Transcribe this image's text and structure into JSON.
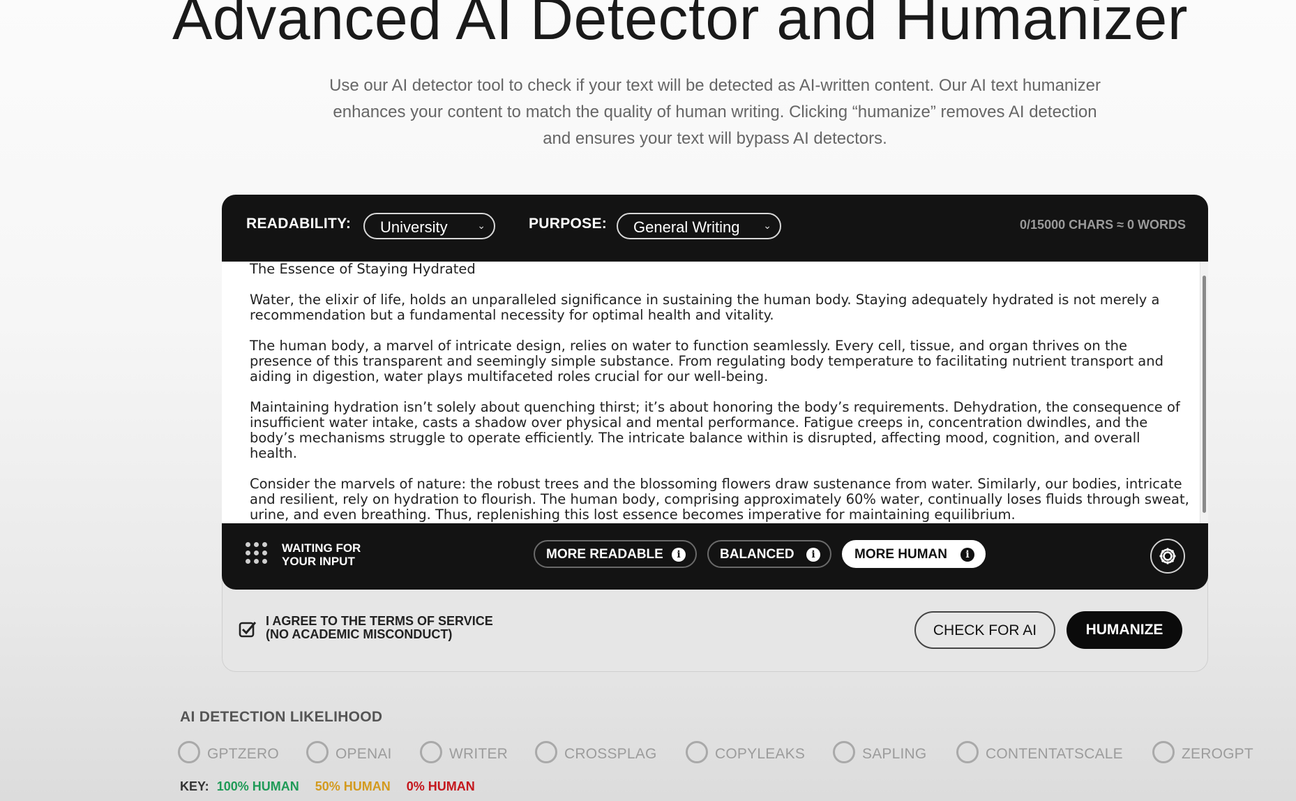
{
  "hero": {
    "title": "Advanced AI Detector and Humanizer",
    "subtitle": "Use our AI detector tool to check if your text will be detected as AI-written content. Our AI text humanizer enhances your content to match the quality of human writing. Clicking “humanize” removes AI detection and ensures your text will bypass AI detectors."
  },
  "toolbar": {
    "readability_label": "READABILITY:",
    "readability_value": "University",
    "purpose_label": "PURPOSE:",
    "purpose_value": "General Writing",
    "counter": "0/15000 CHARS ≈ 0 WORDS"
  },
  "editor": {
    "paragraphs": [
      "The Essence of Staying Hydrated",
      "Water, the elixir of life, holds an unparalleled significance in sustaining the human body. Staying adequately hydrated is not merely a recommendation but a fundamental necessity for optimal health and vitality.",
      "The human body, a marvel of intricate design, relies on water to function seamlessly. Every cell, tissue, and organ thrives on the presence of this transparent and seemingly simple substance. From regulating body temperature to facilitating nutrient transport and aiding in digestion, water plays multifaceted roles crucial for our well-being.",
      "Maintaining hydration isn’t solely about quenching thirst; it’s about honoring the body’s requirements. Dehydration, the consequence of insufficient water intake, casts a shadow over physical and mental performance. Fatigue creeps in, concentration dwindles, and the body’s mechanisms struggle to operate efficiently. The intricate balance within is disrupted, affecting mood, cognition, and overall health.",
      "Consider the marvels of nature: the robust trees and the blossoming flowers draw sustenance from water. Similarly, our bodies, intricate and resilient, rely on hydration to flourish. The human body, comprising approximately 60% water, continually loses fluids through sweat, urine, and even breathing. Thus, replenishing this lost essence becomes imperative for maintaining equilibrium."
    ]
  },
  "bottombar": {
    "status_line1": "WAITING FOR",
    "status_line2": "YOUR INPUT",
    "modes": [
      {
        "label": "MORE READABLE",
        "active": false
      },
      {
        "label": "BALANCED",
        "active": false
      },
      {
        "label": "MORE HUMAN",
        "active": true
      }
    ],
    "info_glyph": "i"
  },
  "actions": {
    "agree_line1": "I AGREE TO THE TERMS OF SERVICE",
    "agree_line2": "(NO ACADEMIC MISCONDUCT)",
    "agree_checked": true,
    "check_label": "CHECK FOR AI",
    "humanize_label": "HUMANIZE"
  },
  "detection": {
    "title": "AI DETECTION LIKELIHOOD",
    "detectors": [
      "GPTZERO",
      "OPENAI",
      "WRITER",
      "CROSSPLAG",
      "COPYLEAKS",
      "SAPLING",
      "CONTENTATSCALE",
      "ZEROGPT"
    ],
    "key_label": "KEY:",
    "key_items": [
      {
        "label": "100% HUMAN",
        "color": "#1f9a57"
      },
      {
        "label": "50% HUMAN",
        "color": "#d39a1e"
      },
      {
        "label": "0% HUMAN",
        "color": "#c4161c"
      }
    ]
  },
  "colors": {
    "dark_panel": "#131313",
    "accent_white": "#ffffff"
  }
}
